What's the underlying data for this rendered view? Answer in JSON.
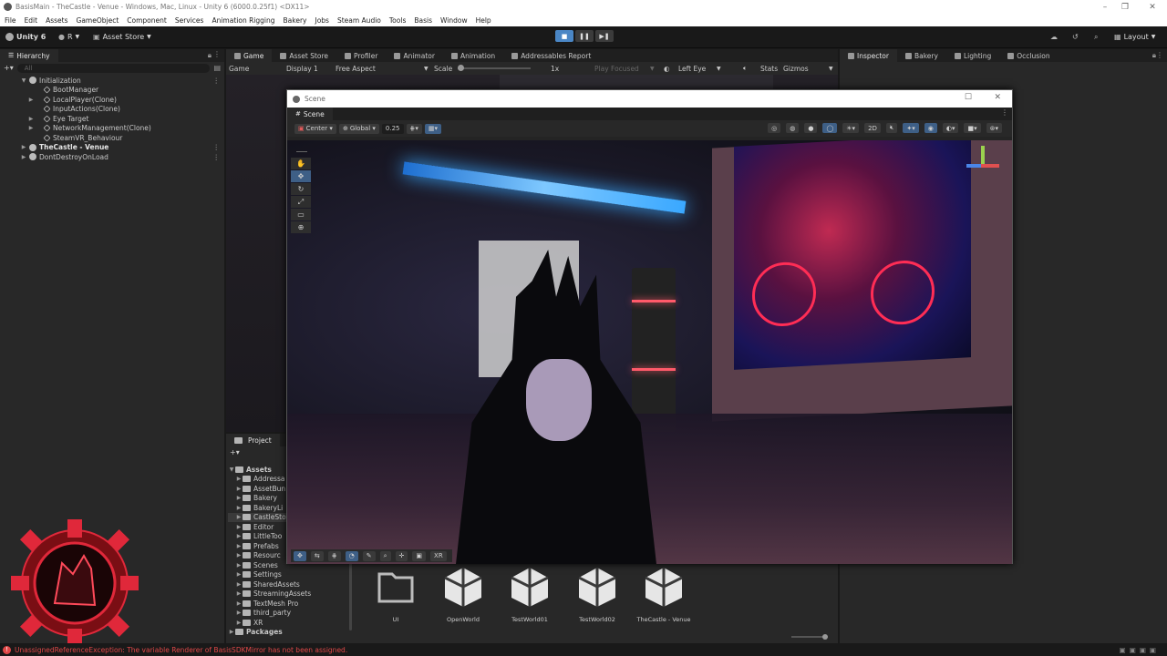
{
  "window": {
    "title": "BasisMain - TheCastle - Venue - Windows, Mac, Linux - Unity 6 (6000.0.25f1) <DX11>"
  },
  "menu": [
    "File",
    "Edit",
    "Assets",
    "GameObject",
    "Component",
    "Services",
    "Animation Rigging",
    "Bakery",
    "Jobs",
    "Steam Audio",
    "Tools",
    "Basis",
    "Window",
    "Help"
  ],
  "toolbar": {
    "account": "Unity 6",
    "initial": "R",
    "asset_store": "Asset Store",
    "layout": "Layout"
  },
  "hierarchy": {
    "tab": "Hierarchy",
    "search_placeholder": "All",
    "items": [
      {
        "label": "Initialization",
        "indent": 0,
        "kind": "scene",
        "bold": false
      },
      {
        "label": "BootManager",
        "indent": 2,
        "kind": "obj",
        "bold": false
      },
      {
        "label": "LocalPlayer(Clone)",
        "indent": 2,
        "kind": "obj",
        "bold": false
      },
      {
        "label": "InputActions(Clone)",
        "indent": 2,
        "kind": "obj",
        "bold": false
      },
      {
        "label": "Eye Target",
        "indent": 2,
        "kind": "obj",
        "bold": false
      },
      {
        "label": "NetworkManagement(Clone)",
        "indent": 2,
        "kind": "obj",
        "bold": false
      },
      {
        "label": "SteamVR_Behaviour",
        "indent": 2,
        "kind": "obj",
        "bold": false
      },
      {
        "label": "TheCastle - Venue",
        "indent": 0,
        "kind": "scene",
        "bold": true
      },
      {
        "label": "DontDestroyOnLoad",
        "indent": 0,
        "kind": "scene",
        "bold": false
      }
    ]
  },
  "center_tabs": [
    "Game",
    "Asset Store",
    "Profiler",
    "Animator",
    "Animation",
    "Addressables Report"
  ],
  "game_toolbar": {
    "mode": "Game",
    "display": "Display 1",
    "aspect": "Free Aspect",
    "scale_label": "Scale",
    "scale_value": "1x",
    "play_focused": "Play Focused",
    "eye": "Left Eye",
    "stats": "Stats",
    "gizmos": "Gizmos"
  },
  "right_tabs": [
    "Inspector",
    "Bakery",
    "Lighting",
    "Occlusion"
  ],
  "scene_window": {
    "title": "Scene",
    "tab": "Scene",
    "pivot": "Center",
    "space": "Global",
    "snap": "0.25",
    "dim": "2D",
    "bottom_label": "XR"
  },
  "project": {
    "tab": "Project",
    "root": "Assets",
    "folders": [
      "Addressa",
      "AssetBun",
      "Bakery",
      "BakeryLi",
      "CastleSto",
      "Editor",
      "LittleToo",
      "Prefabs",
      "Resourc",
      "Scenes",
      "Settings",
      "SharedAssets",
      "StreamingAssets",
      "TextMesh Pro",
      "third_party",
      "XR"
    ],
    "packages": "Packages",
    "assets": [
      {
        "label": "UI",
        "kind": "folder"
      },
      {
        "label": "OpenWorld",
        "kind": "unity"
      },
      {
        "label": "TestWorld01",
        "kind": "unity"
      },
      {
        "label": "TestWorld02",
        "kind": "unity"
      },
      {
        "label": "TheCastle - Venue",
        "kind": "unity"
      }
    ]
  },
  "status": {
    "error": "UnassignedReferenceException: The variable Renderer of BasisSDKMirror has not been assigned."
  },
  "colors": {
    "accent": "#4a86c5",
    "error": "#e04848",
    "neon_blue": "#3aa8ff",
    "neon_pink": "#ff3d6a"
  }
}
